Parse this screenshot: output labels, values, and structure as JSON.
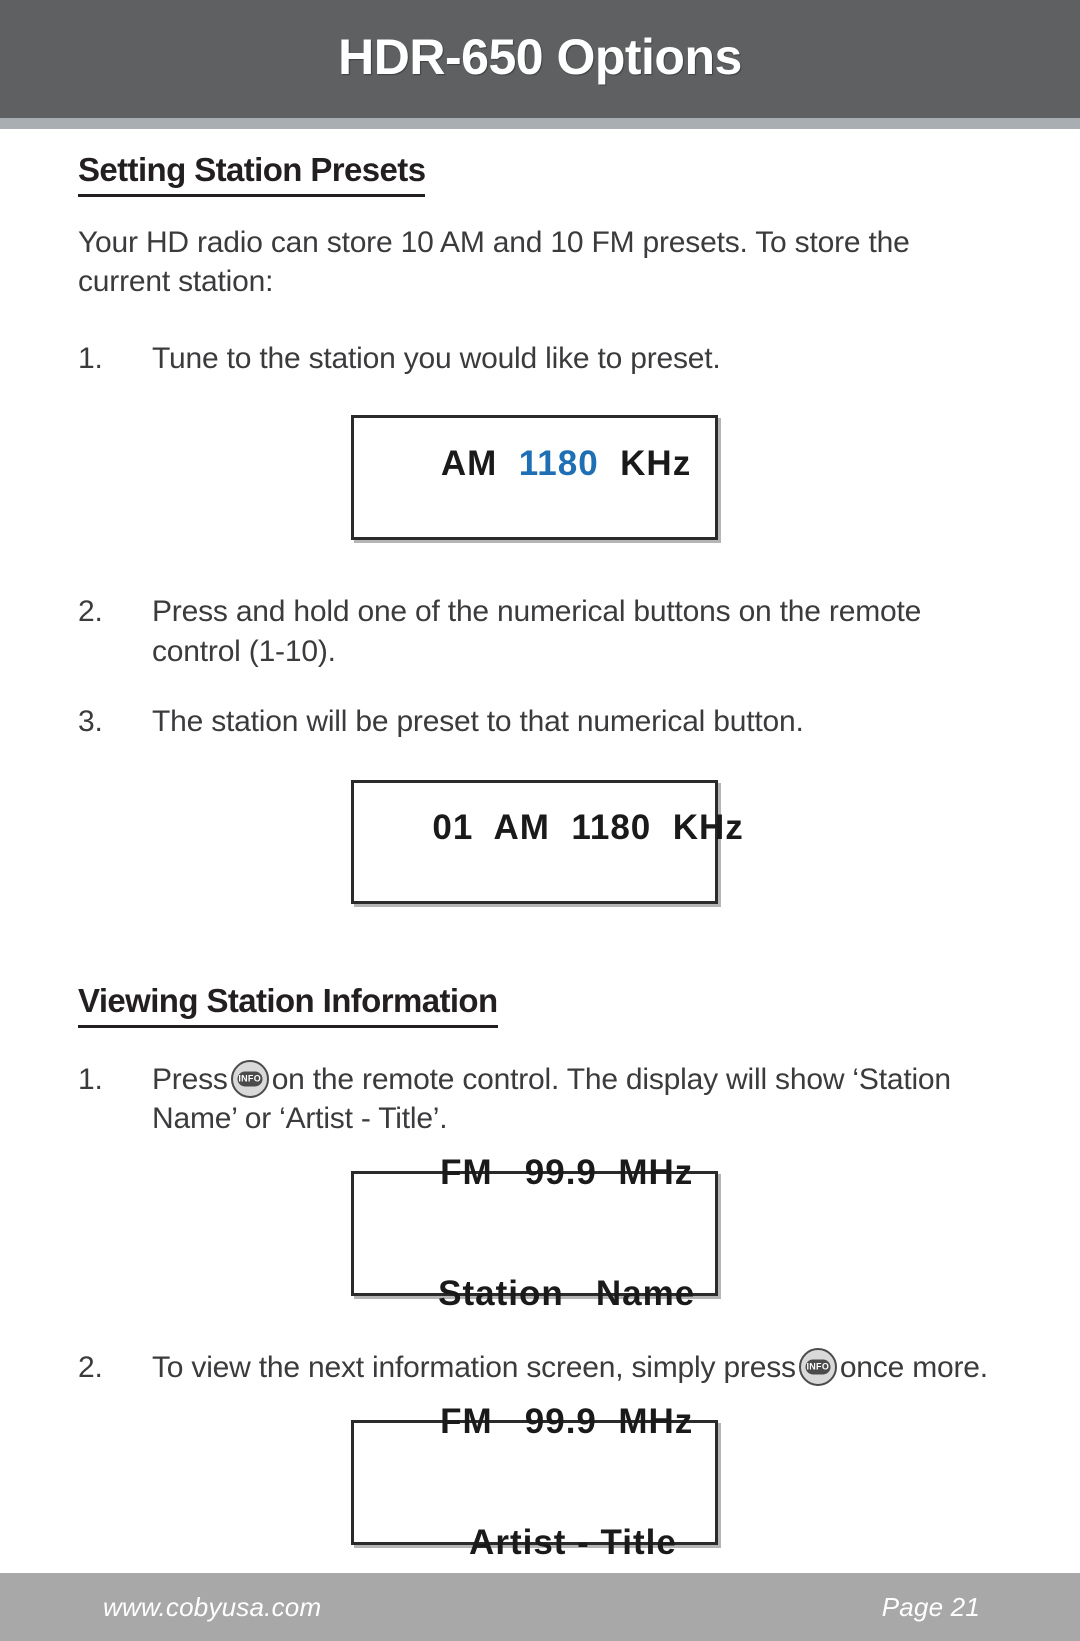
{
  "header": {
    "title": "HDR-650 Options",
    "bg_color": "#5e6062",
    "rule_color": "#a9aeb3"
  },
  "sections": [
    {
      "heading": "Setting Station Presets",
      "intro": "Your HD radio can store 10 AM and 10 FM presets. To store the current station:",
      "steps": [
        {
          "num": "1.",
          "text": "Tune to the station you would like to preset."
        },
        {
          "num": "2.",
          "text": "Press and hold one of the numerical buttons on the remote control (1-10)."
        },
        {
          "num": "3.",
          "text": "The station will be preset to that numerical button."
        }
      ]
    },
    {
      "heading": "Viewing Station Information",
      "steps": [
        {
          "num": "1.",
          "text_before": "Press",
          "icon": "info-button-icon",
          "icon_label": "INFO",
          "text_after": "on the remote control.  The display will show ‘Station Name’ or ‘Artist - Title’."
        },
        {
          "num": "2.",
          "text_before": "To view the next information screen, simply press",
          "icon": "info-button-icon",
          "icon_label": "INFO",
          "text_after": "once more."
        }
      ]
    }
  ],
  "displays": [
    {
      "id": "display-am-preset-tune",
      "lines": [
        {
          "prefix": "AM  ",
          "accent": "1180",
          "suffix": "  KHz",
          "accent_color": "#1f6fb4"
        }
      ]
    },
    {
      "id": "display-am-preset-stored",
      "lines": [
        {
          "prefix": "01  AM  1180  KHz",
          "accent": "",
          "suffix": ""
        }
      ]
    },
    {
      "id": "display-fm-station-name",
      "lines": [
        {
          "prefix": "FM   99.9  MHz",
          "accent": "",
          "suffix": ""
        },
        {
          "prefix": "Station   Name",
          "accent": "",
          "suffix": ""
        }
      ]
    },
    {
      "id": "display-fm-artist-title",
      "lines": [
        {
          "prefix": "FM   99.9  MHz",
          "accent": "",
          "suffix": ""
        },
        {
          "prefix": "Artist - Title",
          "accent": "",
          "suffix": ""
        }
      ]
    }
  ],
  "footer": {
    "website": "www.cobyusa.com",
    "page": "Page 21",
    "bg_color": "#a8a8a8"
  }
}
